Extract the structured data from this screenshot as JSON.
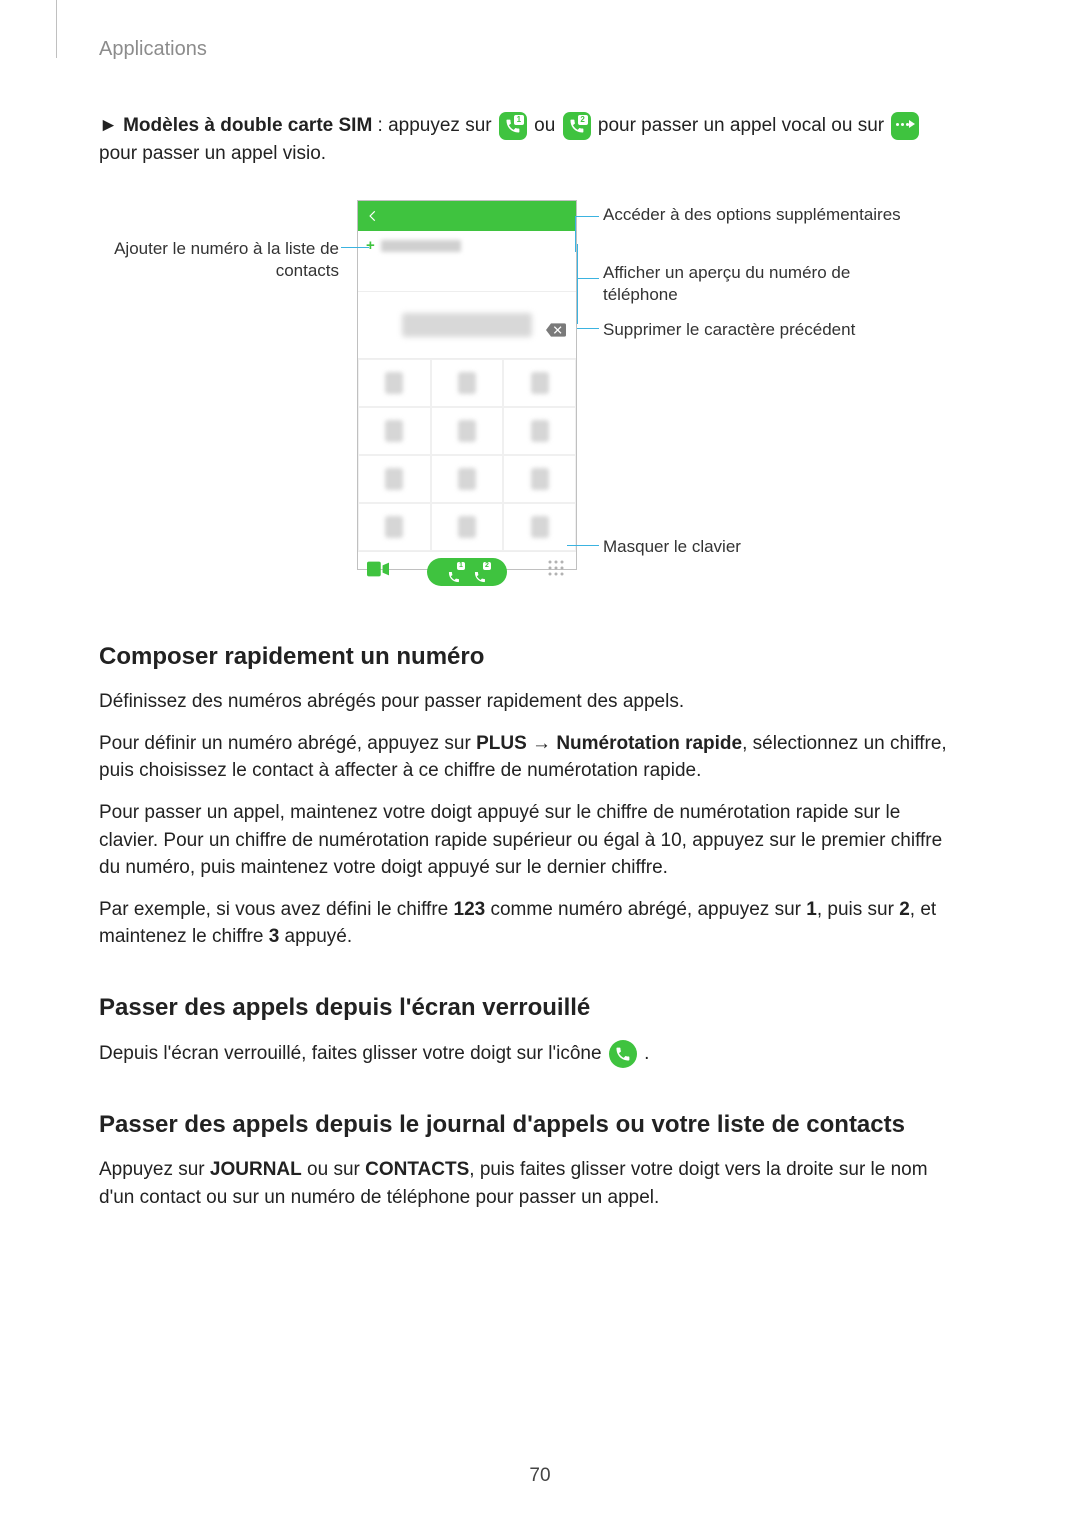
{
  "header": {
    "section": "Applications"
  },
  "intro": {
    "prefix": "► ",
    "bold": "Modèles à double carte SIM",
    "mid1": " : appuyez sur ",
    "mid2": " ou ",
    "mid3": " pour passer un appel vocal ou sur ",
    "end": " pour passer un appel visio."
  },
  "callouts": {
    "left1": "Ajouter le numéro à la liste de contacts",
    "right1": "Accéder à des options supplémentaires",
    "right2": "Afficher un aperçu du numéro de téléphone",
    "right3": "Supprimer le caractère précédent",
    "right4": "Masquer le clavier"
  },
  "sectionA": {
    "title": "Composer rapidement un numéro",
    "p1": "Définissez des numéros abrégés pour passer rapidement des appels.",
    "p2a": "Pour définir un numéro abrégé, appuyez sur ",
    "p2b": "PLUS",
    "p2c": " → ",
    "p2d": "Numérotation rapide",
    "p2e": ", sélectionnez un chiffre, puis choisissez le contact à affecter à ce chiffre de numérotation rapide.",
    "p3": "Pour passer un appel, maintenez votre doigt appuyé sur le chiffre de numérotation rapide sur le clavier. Pour un chiffre de numérotation rapide supérieur ou égal à 10, appuyez sur le premier chiffre du numéro, puis maintenez votre doigt appuyé sur le dernier chiffre.",
    "p4a": "Par exemple, si vous avez défini le chiffre ",
    "p4b": "123",
    "p4c": " comme numéro abrégé, appuyez sur ",
    "p4d": "1",
    "p4e": ", puis sur ",
    "p4f": "2",
    "p4g": ", et maintenez le chiffre ",
    "p4h": "3",
    "p4i": " appuyé."
  },
  "sectionB": {
    "title": "Passer des appels depuis l'écran verrouillé",
    "p1a": "Depuis l'écran verrouillé, faites glisser votre doigt sur l'icône ",
    "p1b": "."
  },
  "sectionC": {
    "title": "Passer des appels depuis le journal d'appels ou votre liste de contacts",
    "p1a": "Appuyez sur ",
    "p1b": "JOURNAL",
    "p1c": " ou sur ",
    "p1d": "CONTACTS",
    "p1e": ", puis faites glisser votre doigt vers la droite sur le nom d'un contact ou sur un numéro de téléphone pour passer un appel."
  },
  "footer": {
    "page": "70"
  },
  "icons": {
    "sim1": "1",
    "sim2": "2"
  }
}
